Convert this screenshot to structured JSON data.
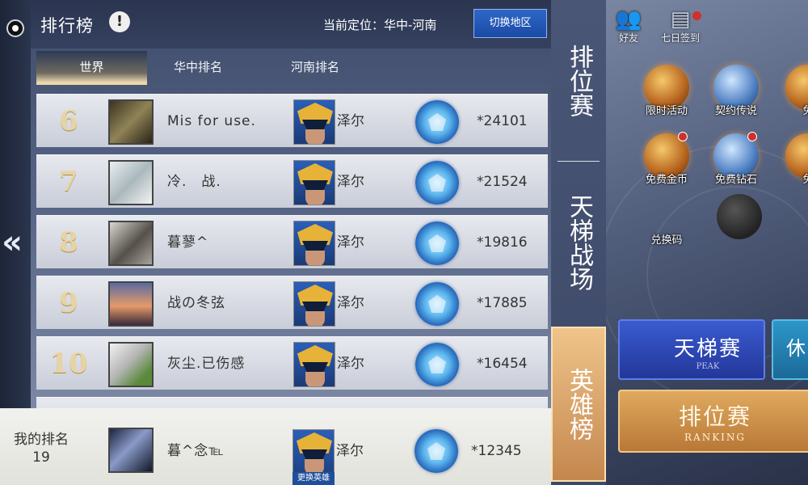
{
  "header": {
    "title": "排行榜",
    "info_glyph": "!",
    "location": "当前定位：华中-河南",
    "switch_region": "切换地区"
  },
  "tabs": [
    "世界",
    "华中排名",
    "河南排名"
  ],
  "rows": [
    {
      "rank": "6",
      "name": "Mis for use.",
      "hero": "泽尔",
      "score": "*24101",
      "avatar_color": "#6b5e3a"
    },
    {
      "rank": "7",
      "name": "冷.　战.",
      "hero": "泽尔",
      "score": "*21524",
      "avatar_color": "#c9d3d6"
    },
    {
      "rank": "8",
      "name": "暮蓼^",
      "hero": "泽尔",
      "score": "*19816",
      "avatar_color": "#8a8478"
    },
    {
      "rank": "9",
      "name": "战の冬弦",
      "hero": "泽尔",
      "score": "*17885",
      "avatar_color": "#c27a5a"
    },
    {
      "rank": "10",
      "name": "灰尘.已伤感",
      "hero": "泽尔",
      "score": "*16454",
      "avatar_color": "#d8d8d8"
    }
  ],
  "my_rank": {
    "label": "我的排名",
    "rank": "19",
    "name": "暮^念℡",
    "hero": "泽尔",
    "score": "*12345",
    "change_hero": "更换英雄"
  },
  "vertical_tabs": [
    "排位赛",
    "天梯战场",
    "英雄榜"
  ],
  "side_icons": {
    "friends": "好友",
    "checkin": "七日签到",
    "limited": "限时活动",
    "contract": "契约传说",
    "free_partial": "免",
    "free_gold": "免费金币",
    "free_diamond": "免费钻石",
    "free_partial2": "免",
    "redeem": "兑换码"
  },
  "modes": {
    "peak_title": "天梯赛",
    "peak_sub": "PEAK",
    "ranking_title": "排位赛",
    "ranking_sub": "RANKING",
    "extra_title": "休"
  },
  "colors": {
    "accent_blue": "#1a4aa5",
    "active_tab_gold": "#c4874e",
    "rank_gold": "#e7d4a3"
  }
}
